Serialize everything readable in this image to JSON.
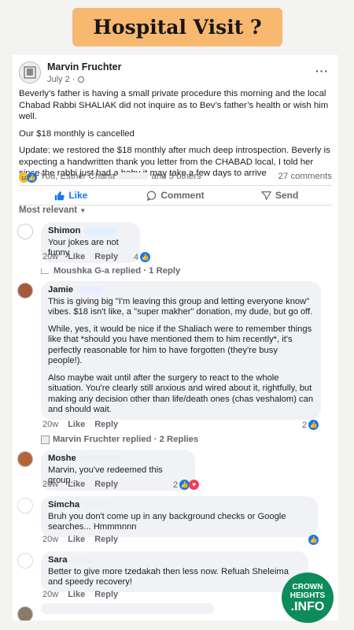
{
  "banner": {
    "title": "Hospital Visit ?"
  },
  "post": {
    "author": "Marvin Fruchter",
    "date": "July 2 ·",
    "more_icon": "···",
    "paragraphs": [
      "Beverly’s father is having a small private procedure this morning and the local Chabad Rabbi SHALIAK did not inquire as to Bev’s father’s health or wish him well.",
      "Our $18 monthly is cancelled",
      "Update: we restored the $18 monthly after much deep introspection. Beverly is expecting a handwritten thank you letter from the CHABAD  local, I told her since the rabbi just had a baby it may take a few days to arrive"
    ],
    "reactions_prefix": "You, Esther Chana",
    "reactions_suffix": "and 5 others",
    "comments_count": "27 comments",
    "actions": {
      "like": "Like",
      "comment": "Comment",
      "send": "Send"
    },
    "sort_label": "Most relevant"
  },
  "comments": [
    {
      "name": "Shimon",
      "lines": [
        "Your jokes are not funny"
      ],
      "time": "20w",
      "like": "Like",
      "reply": "Reply",
      "reactions": "4"
    },
    {
      "name": "Jamie",
      "lines": [
        "This is giving big \"I'm leaving this group and letting everyone know\" vibes. $18 isn't like, a \"super makher\" donation, my dude, but go off.",
        "While, yes, it would be nice if the Shaliach were to remember things like that *should you have mentioned them to him recently*, it's perfectly reasonable for him to have forgotten (they're busy people!).",
        "Also maybe wait until after the surgery to react to the whole situation. You're clearly still anxious and wired about it, rightfully, but making any decision other than life/death ones (chas veshalom) can and should wait."
      ],
      "time": "20w",
      "like": "Like",
      "reply": "Reply",
      "reactions": "2"
    },
    {
      "name": "Moshe",
      "lines": [
        "Marvin, you've redeemed this group."
      ],
      "time": "20w",
      "like": "Like",
      "reply": "Reply",
      "reactions": "2"
    },
    {
      "name": "Simcha",
      "lines": [
        "Bruh you don't come up in any background checks or Google searches... Hmmmnnn"
      ],
      "time": "20w",
      "like": "Like",
      "reply": "Reply",
      "reactions": ""
    },
    {
      "name": "Sara",
      "lines": [
        "Better to give more tzedakah then less now. Refuah Sheleima and speedy recovery!"
      ],
      "time": "20w",
      "like": "Like",
      "reply": "Reply",
      "reactions": ""
    }
  ],
  "replies": [
    {
      "text": "Moushka G-a replied · 1 Reply"
    },
    {
      "text": "Marvin Fruchter replied · 2 Replies"
    }
  ],
  "watermark": {
    "line1": "CROWN",
    "line2": "HEIGHTS",
    "line3": ".INFO"
  },
  "colors": {
    "banner": "#f8b870",
    "like_blue": "#1877f2",
    "bubble": "#f0f2f5",
    "watermark": "#0c8c5a"
  }
}
